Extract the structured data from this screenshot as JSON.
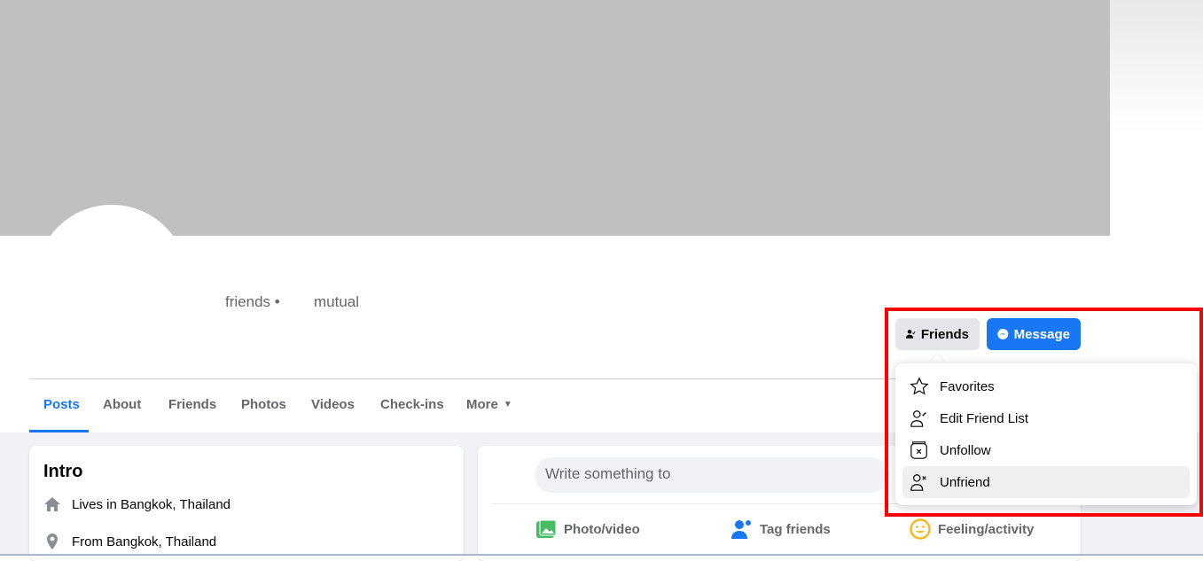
{
  "profile": {
    "friends_label": "friends •",
    "mutual_label": "mutual"
  },
  "tabs": [
    "Posts",
    "About",
    "Friends",
    "Photos",
    "Videos",
    "Check-ins",
    "More"
  ],
  "actions": {
    "friends": "Friends",
    "message": "Message"
  },
  "menu": [
    "Favorites",
    "Edit Friend List",
    "Unfollow",
    "Unfriend"
  ],
  "intro": {
    "title": "Intro",
    "lives_prefix": "Lives in ",
    "lives_place": "Bangkok, Thailand",
    "from_prefix": "From ",
    "from_place": "Bangkok, Thailand"
  },
  "composer": {
    "placeholder": "Write something to",
    "photo": "Photo/video",
    "tag": "Tag friends",
    "feeling": "Feeling/activity"
  },
  "colors": {
    "accent": "#1877f2",
    "highlight": "#ff0000"
  }
}
